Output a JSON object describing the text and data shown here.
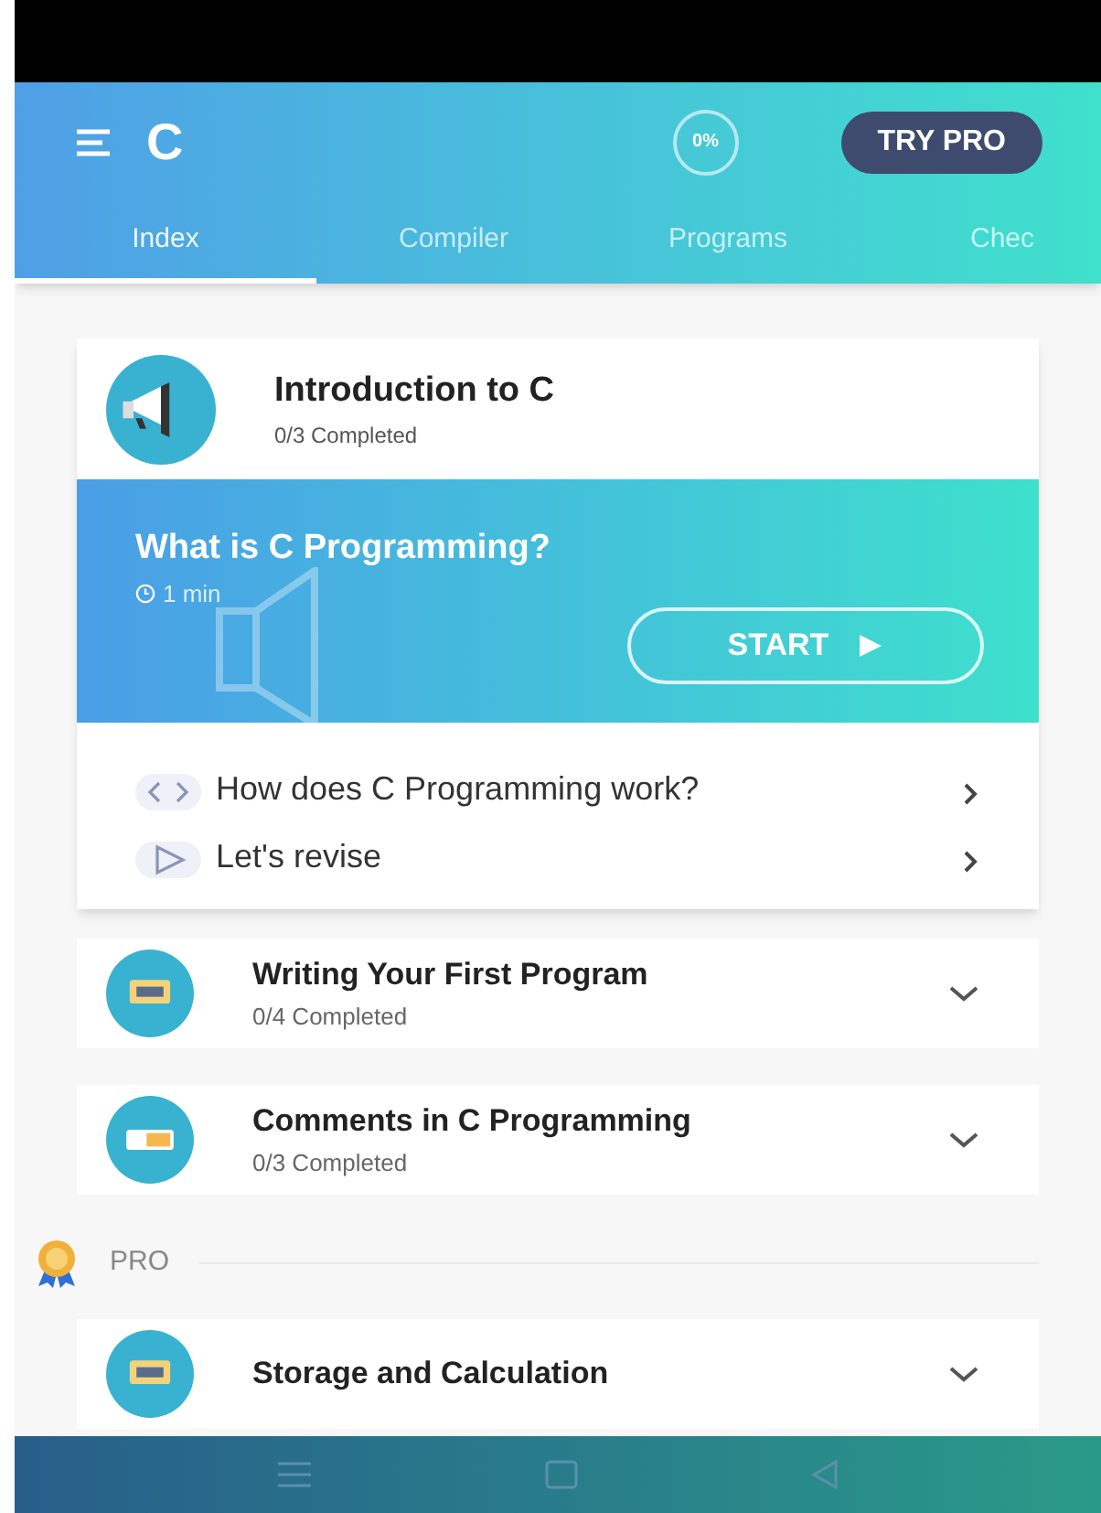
{
  "app_bar": {
    "title": "C",
    "progress_badge": "0%",
    "pro_button": "TRY PRO"
  },
  "tabs": [
    {
      "label": "Index",
      "selected": true
    },
    {
      "label": "Compiler",
      "selected": false
    },
    {
      "label": "Programs",
      "selected": false
    },
    {
      "label": "Chec",
      "selected": false
    }
  ],
  "modules": [
    {
      "title": "Introduction to C",
      "progress": "0/3 Completed",
      "expanded": true,
      "kind": "megaphone",
      "featured": {
        "title": "What is C Programming?",
        "duration": "1 min",
        "button": "START"
      },
      "lessons": [
        {
          "kind": "code",
          "label": "How does C Programming work?"
        },
        {
          "kind": "revise",
          "label": "Let's revise"
        }
      ]
    },
    {
      "title": "Writing Your First Program",
      "progress": "0/4 Completed",
      "expanded": false,
      "kind": "screen"
    },
    {
      "title": "Comments in C Programming",
      "progress": "0/3 Completed",
      "expanded": false,
      "kind": "card"
    }
  ],
  "pro_section": {
    "label": "PRO",
    "modules": [
      {
        "title": "Storage and Calculation",
        "expanded": false,
        "kind": "screen"
      }
    ]
  }
}
